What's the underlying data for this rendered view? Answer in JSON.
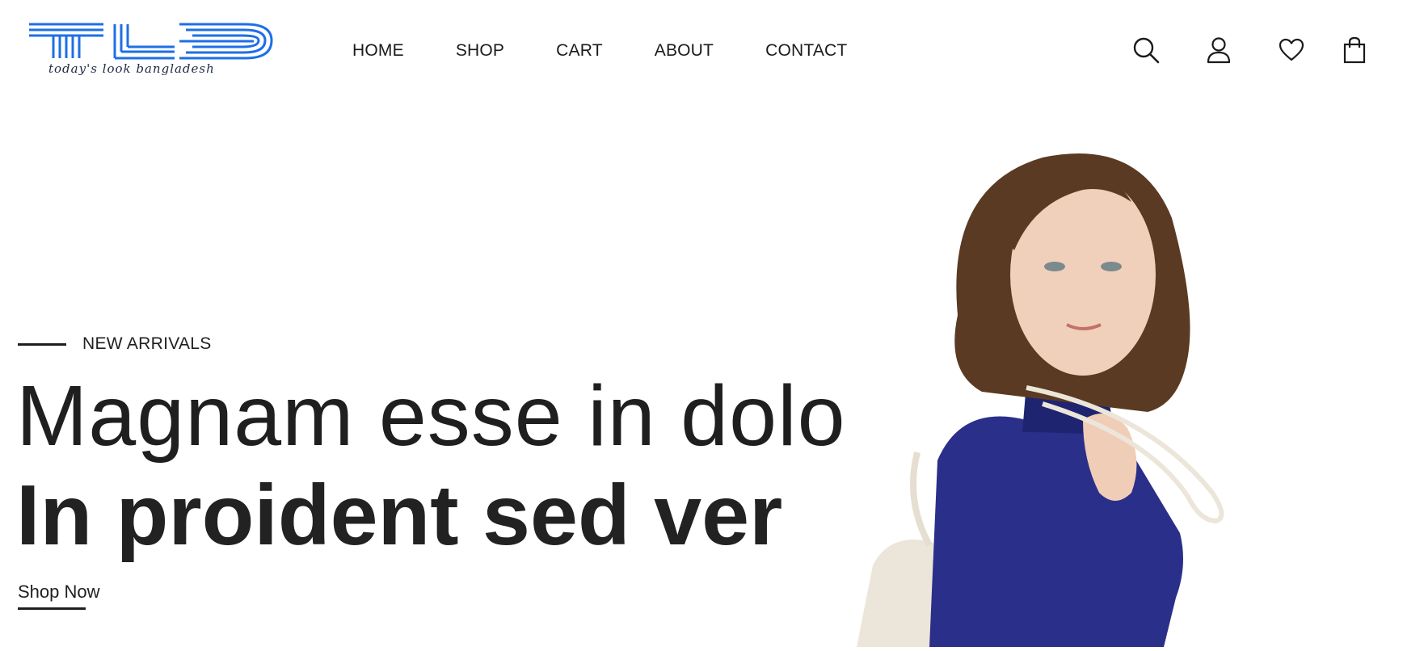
{
  "brand": {
    "logo_letters": "TLB",
    "tagline": "today's look bangladesh",
    "logo_color": "#1e6fe6"
  },
  "nav": {
    "items": [
      {
        "label": "HOME"
      },
      {
        "label": "SHOP"
      },
      {
        "label": "CART"
      },
      {
        "label": "ABOUT"
      },
      {
        "label": "CONTACT"
      }
    ]
  },
  "header_icons": [
    "search-icon",
    "user-icon",
    "heart-icon",
    "shopping-bag-icon"
  ],
  "hero": {
    "eyebrow": "NEW ARRIVALS",
    "headline_light": "Magnam esse in dolo",
    "headline_bold": "In proident sed ver",
    "cta_label": "Shop Now",
    "image": "woman-blue-blouse-with-shoulder-bag"
  },
  "colors": {
    "text": "#1f1f1f",
    "background": "#ffffff",
    "blouse": "#2a2f8a",
    "bag": "#ece6da",
    "hair": "#5a3a22"
  }
}
